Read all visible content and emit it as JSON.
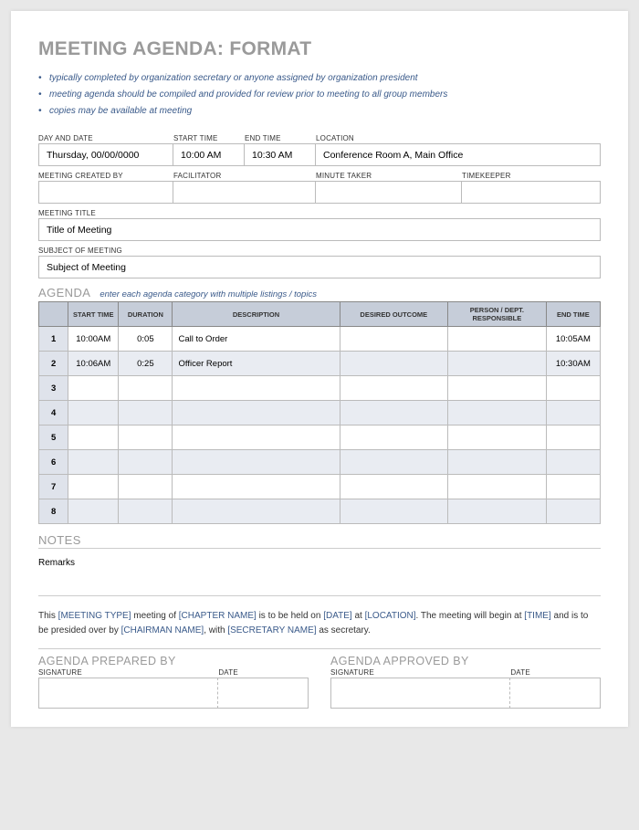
{
  "title": "MEETING AGENDA: FORMAT",
  "instructions": [
    "typically completed by organization secretary or anyone assigned by organization president",
    "meeting agenda should be compiled and provided for review prior to meeting to all group members",
    "copies may be available at meeting"
  ],
  "labels": {
    "day_date": "DAY AND DATE",
    "start_time": "START TIME",
    "end_time": "END TIME",
    "location": "LOCATION",
    "created_by": "MEETING CREATED BY",
    "facilitator": "FACILITATOR",
    "minute_taker": "MINUTE TAKER",
    "timekeeper": "TIMEKEEPER",
    "meeting_title": "MEETING TITLE",
    "subject": "SUBJECT OF MEETING",
    "signature": "SIGNATURE",
    "date": "DATE"
  },
  "values": {
    "day_date": "Thursday, 00/00/0000",
    "start_time": "10:00 AM",
    "end_time": "10:30 AM",
    "location": "Conference Room A, Main Office",
    "created_by": "",
    "facilitator": "",
    "minute_taker": "",
    "timekeeper": "",
    "meeting_title": "Title of Meeting",
    "subject": "Subject of Meeting"
  },
  "agenda": {
    "title": "AGENDA",
    "hint": "enter each agenda category with multiple listings / topics",
    "headers": {
      "start": "START TIME",
      "duration": "DURATION",
      "description": "DESCRIPTION",
      "outcome": "DESIRED OUTCOME",
      "person": "PERSON / DEPT. RESPONSIBLE",
      "end": "END TIME"
    },
    "rows": [
      {
        "num": "1",
        "start": "10:00AM",
        "duration": "0:05",
        "description": "Call to Order",
        "outcome": "",
        "person": "",
        "end": "10:05AM"
      },
      {
        "num": "2",
        "start": "10:06AM",
        "duration": "0:25",
        "description": "Officer Report",
        "outcome": "",
        "person": "",
        "end": "10:30AM"
      },
      {
        "num": "3",
        "start": "",
        "duration": "",
        "description": "",
        "outcome": "",
        "person": "",
        "end": ""
      },
      {
        "num": "4",
        "start": "",
        "duration": "",
        "description": "",
        "outcome": "",
        "person": "",
        "end": ""
      },
      {
        "num": "5",
        "start": "",
        "duration": "",
        "description": "",
        "outcome": "",
        "person": "",
        "end": ""
      },
      {
        "num": "6",
        "start": "",
        "duration": "",
        "description": "",
        "outcome": "",
        "person": "",
        "end": ""
      },
      {
        "num": "7",
        "start": "",
        "duration": "",
        "description": "",
        "outcome": "",
        "person": "",
        "end": ""
      },
      {
        "num": "8",
        "start": "",
        "duration": "",
        "description": "",
        "outcome": "",
        "person": "",
        "end": ""
      }
    ]
  },
  "notes": {
    "title": "NOTES",
    "body": "Remarks"
  },
  "narrative": {
    "t0": "This ",
    "p0": "[MEETING TYPE]",
    "t1": " meeting of ",
    "p1": "[CHAPTER NAME]",
    "t2": " is to be held on ",
    "p2": "[DATE]",
    "t3": " at ",
    "p3": "[LOCATION]",
    "t4": ".  The meeting will begin at ",
    "p4": "[TIME]",
    "t5": " and is to be presided over by ",
    "p5": "[CHAIRMAN NAME]",
    "t6": ", with ",
    "p6": "[SECRETARY NAME]",
    "t7": " as secretary."
  },
  "signoff": {
    "prepared": "AGENDA PREPARED BY",
    "approved": "AGENDA APPROVED BY"
  }
}
